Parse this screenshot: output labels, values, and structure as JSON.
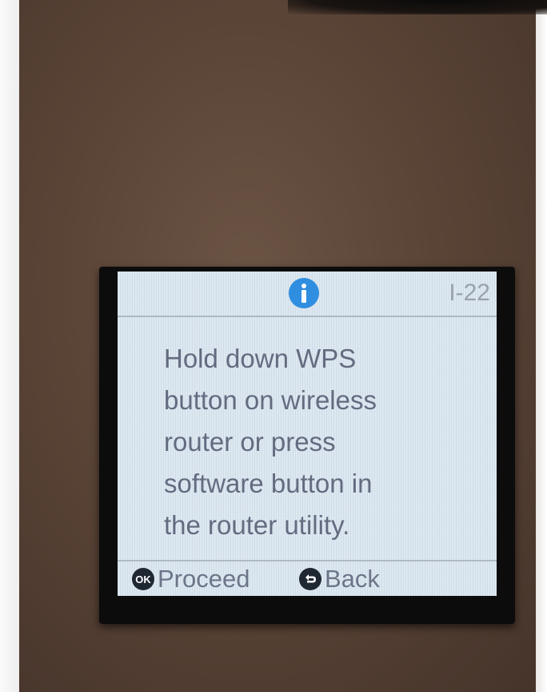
{
  "screen": {
    "code": "I-22",
    "message_lines": [
      "Hold down WPS",
      "button on wireless",
      "router or press",
      "software button in",
      "the router utility."
    ]
  },
  "footer": {
    "ok": {
      "key": "OK",
      "label": "Proceed"
    },
    "back": {
      "label": "Back"
    }
  },
  "icons": {
    "status": "info-icon",
    "ok": "ok-button-icon",
    "back": "back-arrow-icon"
  },
  "colors": {
    "lcd_background": "#dbe7f1",
    "info_blue": "#2f8ee0",
    "text": "#646b80",
    "key_badge": "#1f2733"
  }
}
